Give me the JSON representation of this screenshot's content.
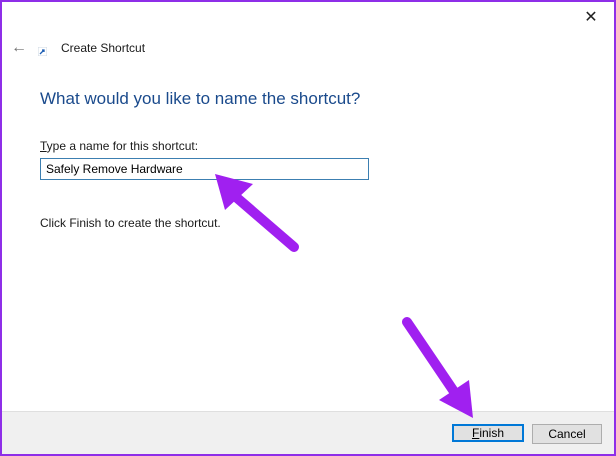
{
  "window": {
    "close_glyph": "✕",
    "back_glyph": "←"
  },
  "header": {
    "title": "Create Shortcut"
  },
  "main": {
    "heading": "What would you like to name the shortcut?",
    "label_accel": "T",
    "label_rest": "ype a name for this shortcut:",
    "name_value": "Safely Remove Hardware",
    "finish_hint": "Click Finish to create the shortcut."
  },
  "footer": {
    "finish_accel": "F",
    "finish_rest": "inish",
    "cancel_label": "Cancel"
  },
  "annotations": {
    "arrow_color": "#a020f0"
  },
  "colors": {
    "accent": "#0078d7",
    "heading": "#1a4a8c",
    "border": "#8e2ee8"
  }
}
